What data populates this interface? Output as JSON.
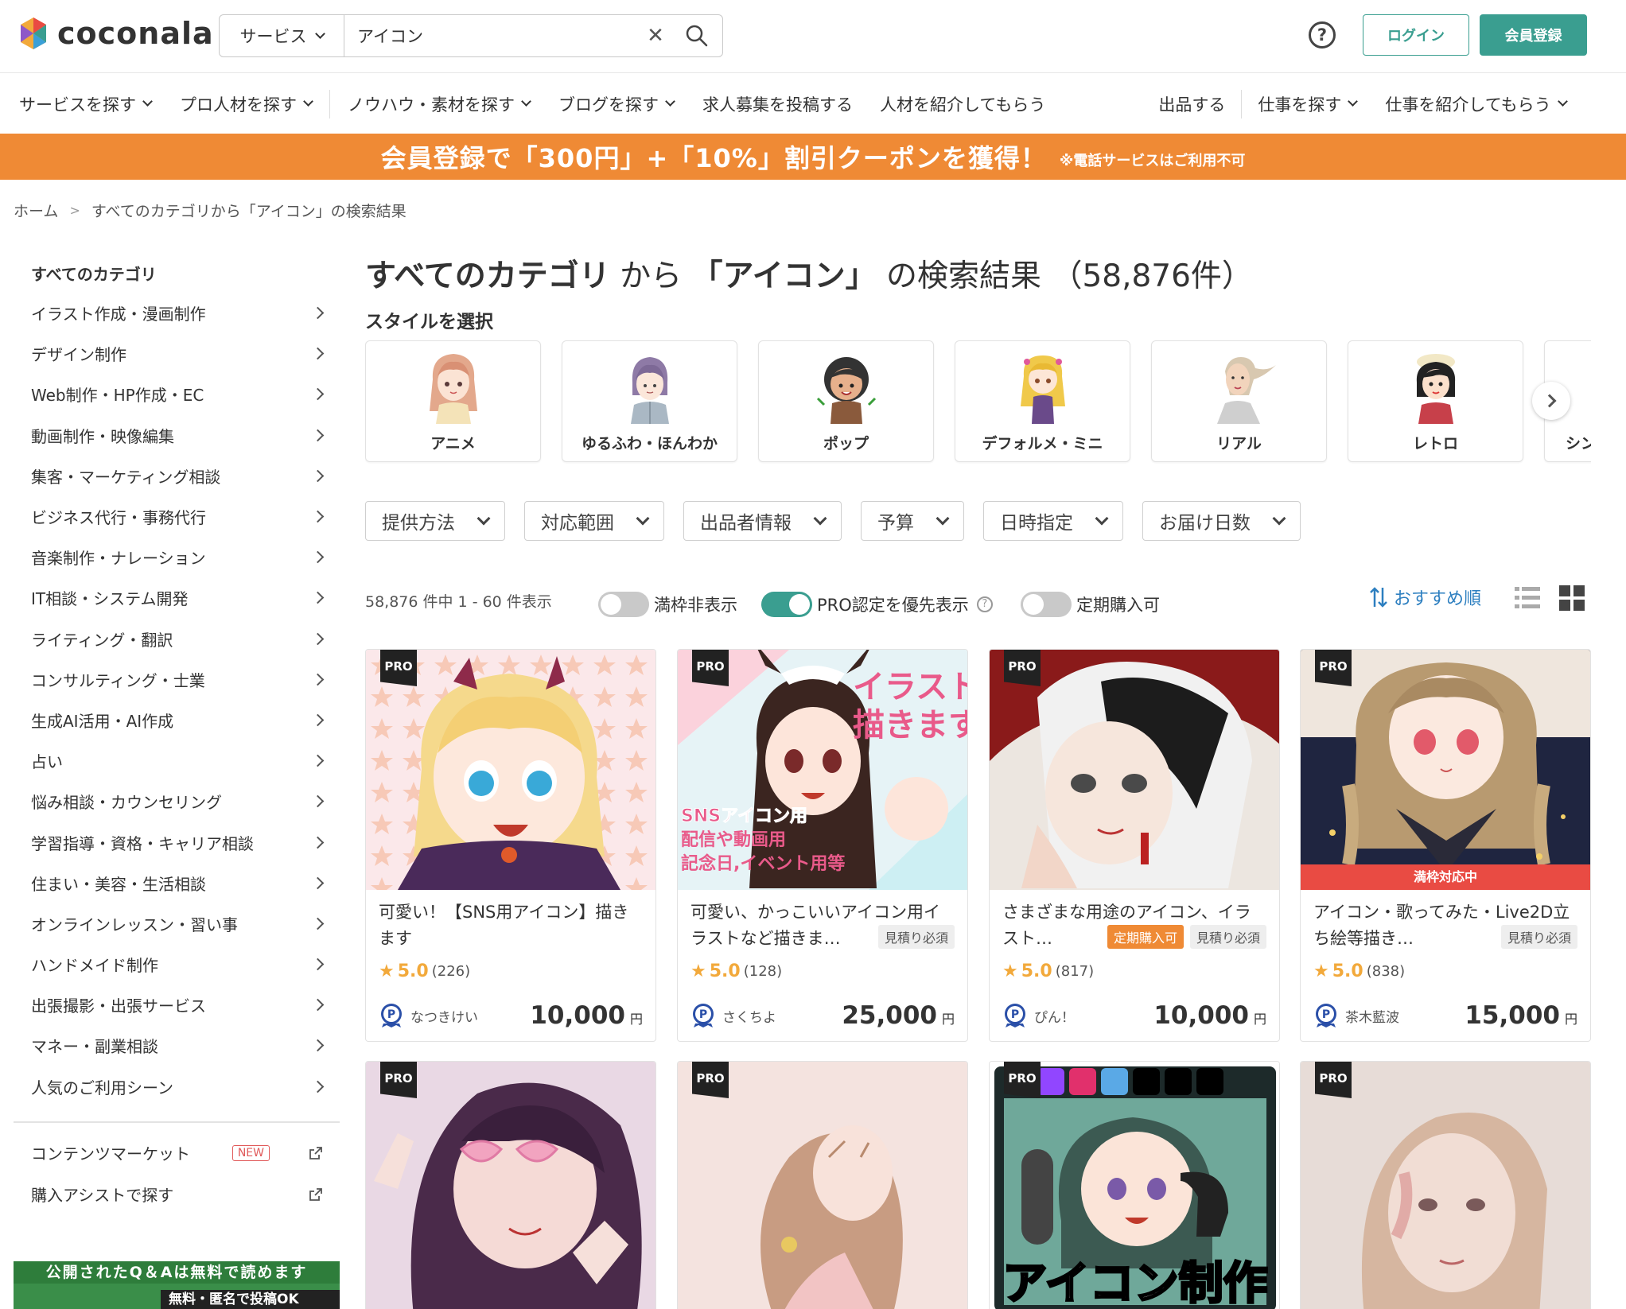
{
  "header": {
    "logo_text": "coconala",
    "search_category": "サービス",
    "search_value": "アイコン",
    "help_label": "?",
    "login_label": "ログイン",
    "signup_label": "会員登録"
  },
  "nav": {
    "left": [
      {
        "label": "サービスを探す",
        "has_dropdown": true
      },
      {
        "label": "プロ人材を探す",
        "has_dropdown": true
      },
      {
        "label": "ノウハウ・素材を探す",
        "has_dropdown": true
      },
      {
        "label": "ブログを探す",
        "has_dropdown": true
      },
      {
        "label": "求人募集を投稿する",
        "has_dropdown": false
      },
      {
        "label": "人材を紹介してもらう",
        "has_dropdown": false
      }
    ],
    "right": [
      {
        "label": "出品する",
        "has_dropdown": false
      },
      {
        "label": "仕事を探す",
        "has_dropdown": true
      },
      {
        "label": "仕事を紹介してもらう",
        "has_dropdown": true
      }
    ]
  },
  "banner": {
    "main": "会員登録で「300円」+「10%」割引クーポンを獲得！",
    "note": "※電話サービスはご利用不可"
  },
  "breadcrumb": {
    "home": "ホーム",
    "current": "すべてのカテゴリから「アイコン」の検索結果"
  },
  "sidebar": {
    "title": "すべてのカテゴリ",
    "items": [
      "イラスト作成・漫画制作",
      "デザイン制作",
      "Web制作・HP作成・EC",
      "動画制作・映像編集",
      "集客・マーケティング相談",
      "ビジネス代行・事務代行",
      "音楽制作・ナレーション",
      "IT相談・システム開発",
      "ライティング・翻訳",
      "コンサルティング・士業",
      "生成AI活用・AI作成",
      "占い",
      "悩み相談・カウンセリング",
      "学習指導・資格・キャリア相談",
      "住まい・美容・生活相談",
      "オンラインレッスン・習い事",
      "ハンドメイド制作",
      "出張撮影・出張サービス",
      "マネー・副業相談",
      "人気のご利用シーン"
    ],
    "extras": {
      "content_market": "コンテンツマーケット",
      "new_badge": "NEW",
      "assist": "購入アシストで探す"
    },
    "ad": {
      "line1": "公開されたQ＆Aは無料で読めます",
      "line2": "無料・匿名で投稿OK"
    }
  },
  "main": {
    "title_bold1": "すべてのカテゴリ",
    "title_thin1": "から",
    "title_bold2": "「アイコン」",
    "title_thin2": "の検索結果",
    "title_count": "（58,876件）",
    "style_label": "スタイルを選択",
    "styles": [
      "アニメ",
      "ゆるふわ・ほんわか",
      "ポップ",
      "デフォルメ・ミニ",
      "リアル",
      "レトロ",
      "シン"
    ],
    "filters": [
      "提供方法",
      "対応範囲",
      "出品者情報",
      "予算",
      "日時指定",
      "お届け日数"
    ],
    "result_count": "58,876 件中 1 - 60 件表示",
    "toggles": {
      "hide_full": {
        "label": "満枠非表示",
        "on": false
      },
      "pro_first": {
        "label": "PRO認定を優先表示",
        "on": true
      },
      "subscription": {
        "label": "定期購入可",
        "on": false
      }
    },
    "sort_label": "おすすめ順"
  },
  "cards": [
    {
      "title": "可愛い！【SNS用アイコン】描きます",
      "rating": "5.0",
      "count": "(226)",
      "seller": "なつきけい",
      "price": "10,000",
      "unit": "円",
      "pro": "PRO",
      "tags": []
    },
    {
      "title": "可愛い、かっこいいアイコン用イラストなど描きま…",
      "rating": "5.0",
      "count": "(128)",
      "seller": "さくちよ",
      "price": "25,000",
      "unit": "円",
      "pro": "PRO",
      "tags": [
        "見積り必須"
      ]
    },
    {
      "title": "さまざまな用途のアイコン、イラスト…",
      "rating": "5.0",
      "count": "(817)",
      "seller": "ぴん！",
      "price": "10,000",
      "unit": "円",
      "pro": "PRO",
      "tags": [
        "定期購入可",
        "見積り必須"
      ]
    },
    {
      "title": "アイコン・歌ってみた・Live2D立ち絵等描き…",
      "rating": "5.0",
      "count": "(838)",
      "seller": "茶木藍波",
      "price": "15,000",
      "unit": "円",
      "pro": "PRO",
      "tags": [
        "見積り必須"
      ],
      "full_badge": "満枠対応中"
    },
    {
      "pro": "PRO"
    },
    {
      "pro": "PRO"
    },
    {
      "pro": "PRO",
      "overlay_text": "アイコン制作"
    },
    {
      "pro": "PRO"
    }
  ],
  "colors": {
    "accent": "#3a9e90",
    "banner": "#ef8a35",
    "star": "#f2a93b",
    "full_badge": "#e94b43",
    "link": "#2d7fc0"
  }
}
